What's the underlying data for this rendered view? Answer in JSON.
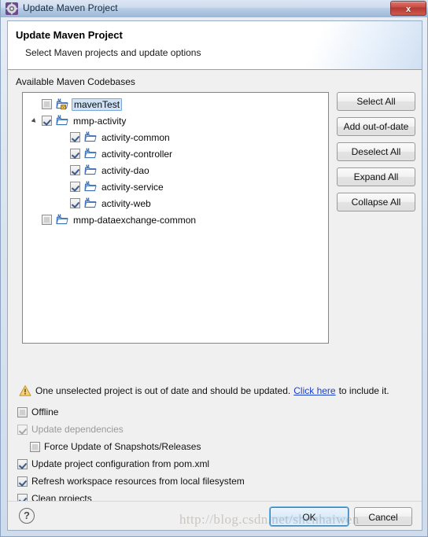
{
  "window": {
    "title": "Update Maven Project",
    "icon": "maven-gear-icon",
    "close_label": "x"
  },
  "header": {
    "title": "Update Maven Project",
    "subtitle": "Select Maven projects and update options"
  },
  "tree_section": {
    "label": "Available Maven Codebases",
    "items": [
      {
        "label": "mavenTest",
        "checked": false,
        "indent": 0,
        "selected": true,
        "twisty": false
      },
      {
        "label": "mmp-activity",
        "checked": true,
        "indent": 0,
        "selected": false,
        "twisty": true
      },
      {
        "label": "activity-common",
        "checked": true,
        "indent": 1,
        "selected": false,
        "twisty": false
      },
      {
        "label": "activity-controller",
        "checked": true,
        "indent": 1,
        "selected": false,
        "twisty": false
      },
      {
        "label": "activity-dao",
        "checked": true,
        "indent": 1,
        "selected": false,
        "twisty": false
      },
      {
        "label": "activity-service",
        "checked": true,
        "indent": 1,
        "selected": false,
        "twisty": false
      },
      {
        "label": "activity-web",
        "checked": true,
        "indent": 1,
        "selected": false,
        "twisty": false
      },
      {
        "label": "mmp-dataexchange-common",
        "checked": false,
        "indent": 0,
        "selected": false,
        "twisty": false
      }
    ]
  },
  "side_buttons": [
    {
      "label": "Select All"
    },
    {
      "label": "Add out-of-date"
    },
    {
      "label": "Deselect All"
    },
    {
      "label": "Expand All"
    },
    {
      "label": "Collapse All"
    }
  ],
  "warning": {
    "icon": "warning-triangle-icon",
    "text_before": "One unselected project is out of date and should be updated.",
    "link": "Click here",
    "text_after": "to include it."
  },
  "options": [
    {
      "label": "Offline",
      "checked": false,
      "disabled": false,
      "sub": false
    },
    {
      "label": "Update dependencies",
      "checked": true,
      "disabled": true,
      "sub": false
    },
    {
      "label": "Force Update of Snapshots/Releases",
      "checked": false,
      "disabled": false,
      "sub": true
    },
    {
      "label": "Update project configuration from pom.xml",
      "checked": true,
      "disabled": false,
      "sub": false
    },
    {
      "label": "Refresh workspace resources from local filesystem",
      "checked": true,
      "disabled": false,
      "sub": false
    },
    {
      "label": "Clean projects",
      "checked": true,
      "disabled": false,
      "sub": false
    }
  ],
  "footer": {
    "help_label": "?",
    "ok_label": "OK",
    "cancel_label": "Cancel"
  },
  "watermark": "http://blog.csdn.net/shenhaiwen",
  "colors": {
    "accent": "#3c7fb1",
    "link": "#1a3fcf",
    "selection": "#cfe2f6",
    "close_red": "#c94f45",
    "warning_amber": "#f2c14b"
  }
}
